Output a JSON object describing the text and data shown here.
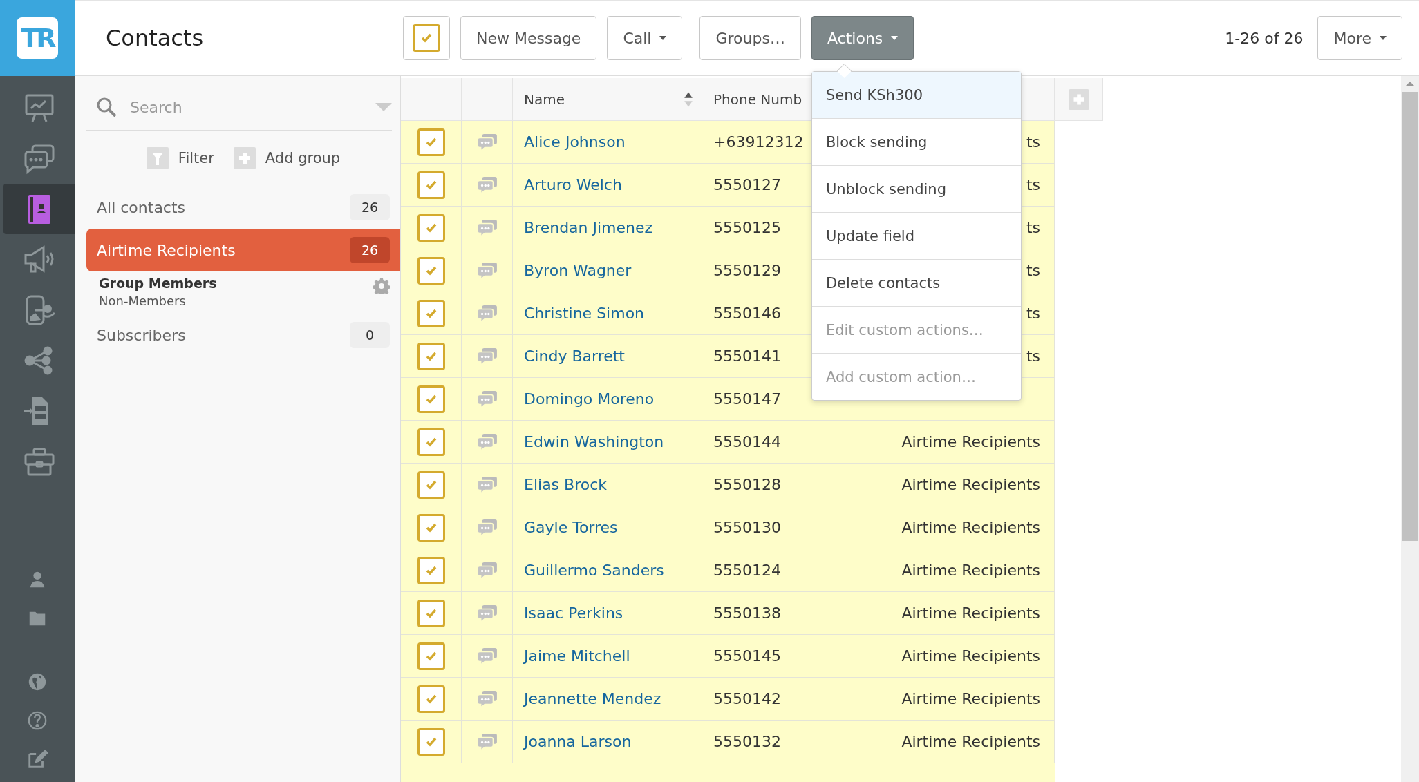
{
  "app": {
    "logo_text": "TR"
  },
  "sidebar": {
    "items": [
      {
        "kind": "dashboard",
        "selected": false
      },
      {
        "kind": "messages",
        "selected": false
      },
      {
        "kind": "contacts",
        "selected": true
      },
      {
        "kind": "campaigns",
        "selected": false
      },
      {
        "kind": "flows",
        "selected": false
      },
      {
        "kind": "share",
        "selected": false
      },
      {
        "kind": "sim",
        "selected": false
      },
      {
        "kind": "tools",
        "selected": false
      }
    ],
    "bottom_items": [
      {
        "kind": "user"
      },
      {
        "kind": "folder"
      },
      {
        "kind": "globe"
      },
      {
        "kind": "help"
      },
      {
        "kind": "edit"
      }
    ]
  },
  "header": {
    "title": "Contacts",
    "select_all_checked": true,
    "buttons": [
      {
        "label": "New Message",
        "kind": "plain",
        "active": false
      },
      {
        "label": "Call",
        "kind": "dropdown",
        "active": false
      },
      {
        "label": "Groups…",
        "kind": "plain",
        "active": false
      },
      {
        "label": "Actions",
        "kind": "dropdown",
        "active": true
      }
    ],
    "range": "1-26 of 26",
    "more": {
      "label": "More",
      "kind": "dropdown"
    }
  },
  "actions_menu": {
    "items": [
      {
        "label": "Send KSh300",
        "selected": true,
        "disabled": false
      },
      {
        "label": "Block sending",
        "selected": false,
        "disabled": false
      },
      {
        "label": "Unblock sending",
        "selected": false,
        "disabled": false
      },
      {
        "label": "Update field",
        "selected": false,
        "disabled": false
      },
      {
        "label": "Delete contacts",
        "selected": false,
        "disabled": false
      },
      {
        "label": "Edit custom actions…",
        "selected": false,
        "disabled": true
      },
      {
        "label": "Add custom action…",
        "selected": false,
        "disabled": true
      }
    ]
  },
  "groups_panel": {
    "search": {
      "placeholder": "Search"
    },
    "filter": "Filter",
    "add_group": "Add group",
    "groups": [
      {
        "label": "All contacts",
        "count": "26",
        "selected": false
      },
      {
        "label": "Airtime Recipients",
        "count": "26",
        "selected": true,
        "details": {
          "title": "Group Members",
          "subtitle": "Non-Members"
        }
      },
      {
        "label": "Subscribers",
        "count": "0",
        "selected": false
      }
    ]
  },
  "table": {
    "columns": [
      {
        "label": "Name",
        "sort_ascending": true
      },
      {
        "label": "Phone Numb"
      }
    ],
    "rows": [
      {
        "checked": true,
        "name": "Alice Johnson",
        "phone": "+63912312",
        "group": "ts"
      },
      {
        "checked": true,
        "name": "Arturo Welch",
        "phone": "5550127",
        "group": "ts"
      },
      {
        "checked": true,
        "name": "Brendan Jimenez",
        "phone": "5550125",
        "group": "ts"
      },
      {
        "checked": true,
        "name": "Byron Wagner",
        "phone": "5550129",
        "group": "ts"
      },
      {
        "checked": true,
        "name": "Christine Simon",
        "phone": "5550146",
        "group": "ts"
      },
      {
        "checked": true,
        "name": "Cindy Barrett",
        "phone": "5550141",
        "group": "ts"
      },
      {
        "checked": true,
        "name": "Domingo Moreno",
        "phone": "5550147"
      },
      {
        "checked": true,
        "name": "Edwin Washington",
        "phone": "5550144",
        "group": "Airtime Recipients"
      },
      {
        "checked": true,
        "name": "Elias Brock",
        "phone": "5550128",
        "group": "Airtime Recipients"
      },
      {
        "checked": true,
        "name": "Gayle Torres",
        "phone": "5550130",
        "group": "Airtime Recipients"
      },
      {
        "checked": true,
        "name": "Guillermo Sanders",
        "phone": "5550124",
        "group": "Airtime Recipients"
      },
      {
        "checked": true,
        "name": "Isaac Perkins",
        "phone": "5550138",
        "group": "Airtime Recipients"
      },
      {
        "checked": true,
        "name": "Jaime Mitchell",
        "phone": "5550145",
        "group": "Airtime Recipients"
      },
      {
        "checked": true,
        "name": "Jeannette Mendez",
        "phone": "5550142",
        "group": "Airtime Recipients"
      },
      {
        "checked": true,
        "name": "Joanna Larson",
        "phone": "5550132",
        "group": "Airtime Recipients"
      }
    ]
  }
}
